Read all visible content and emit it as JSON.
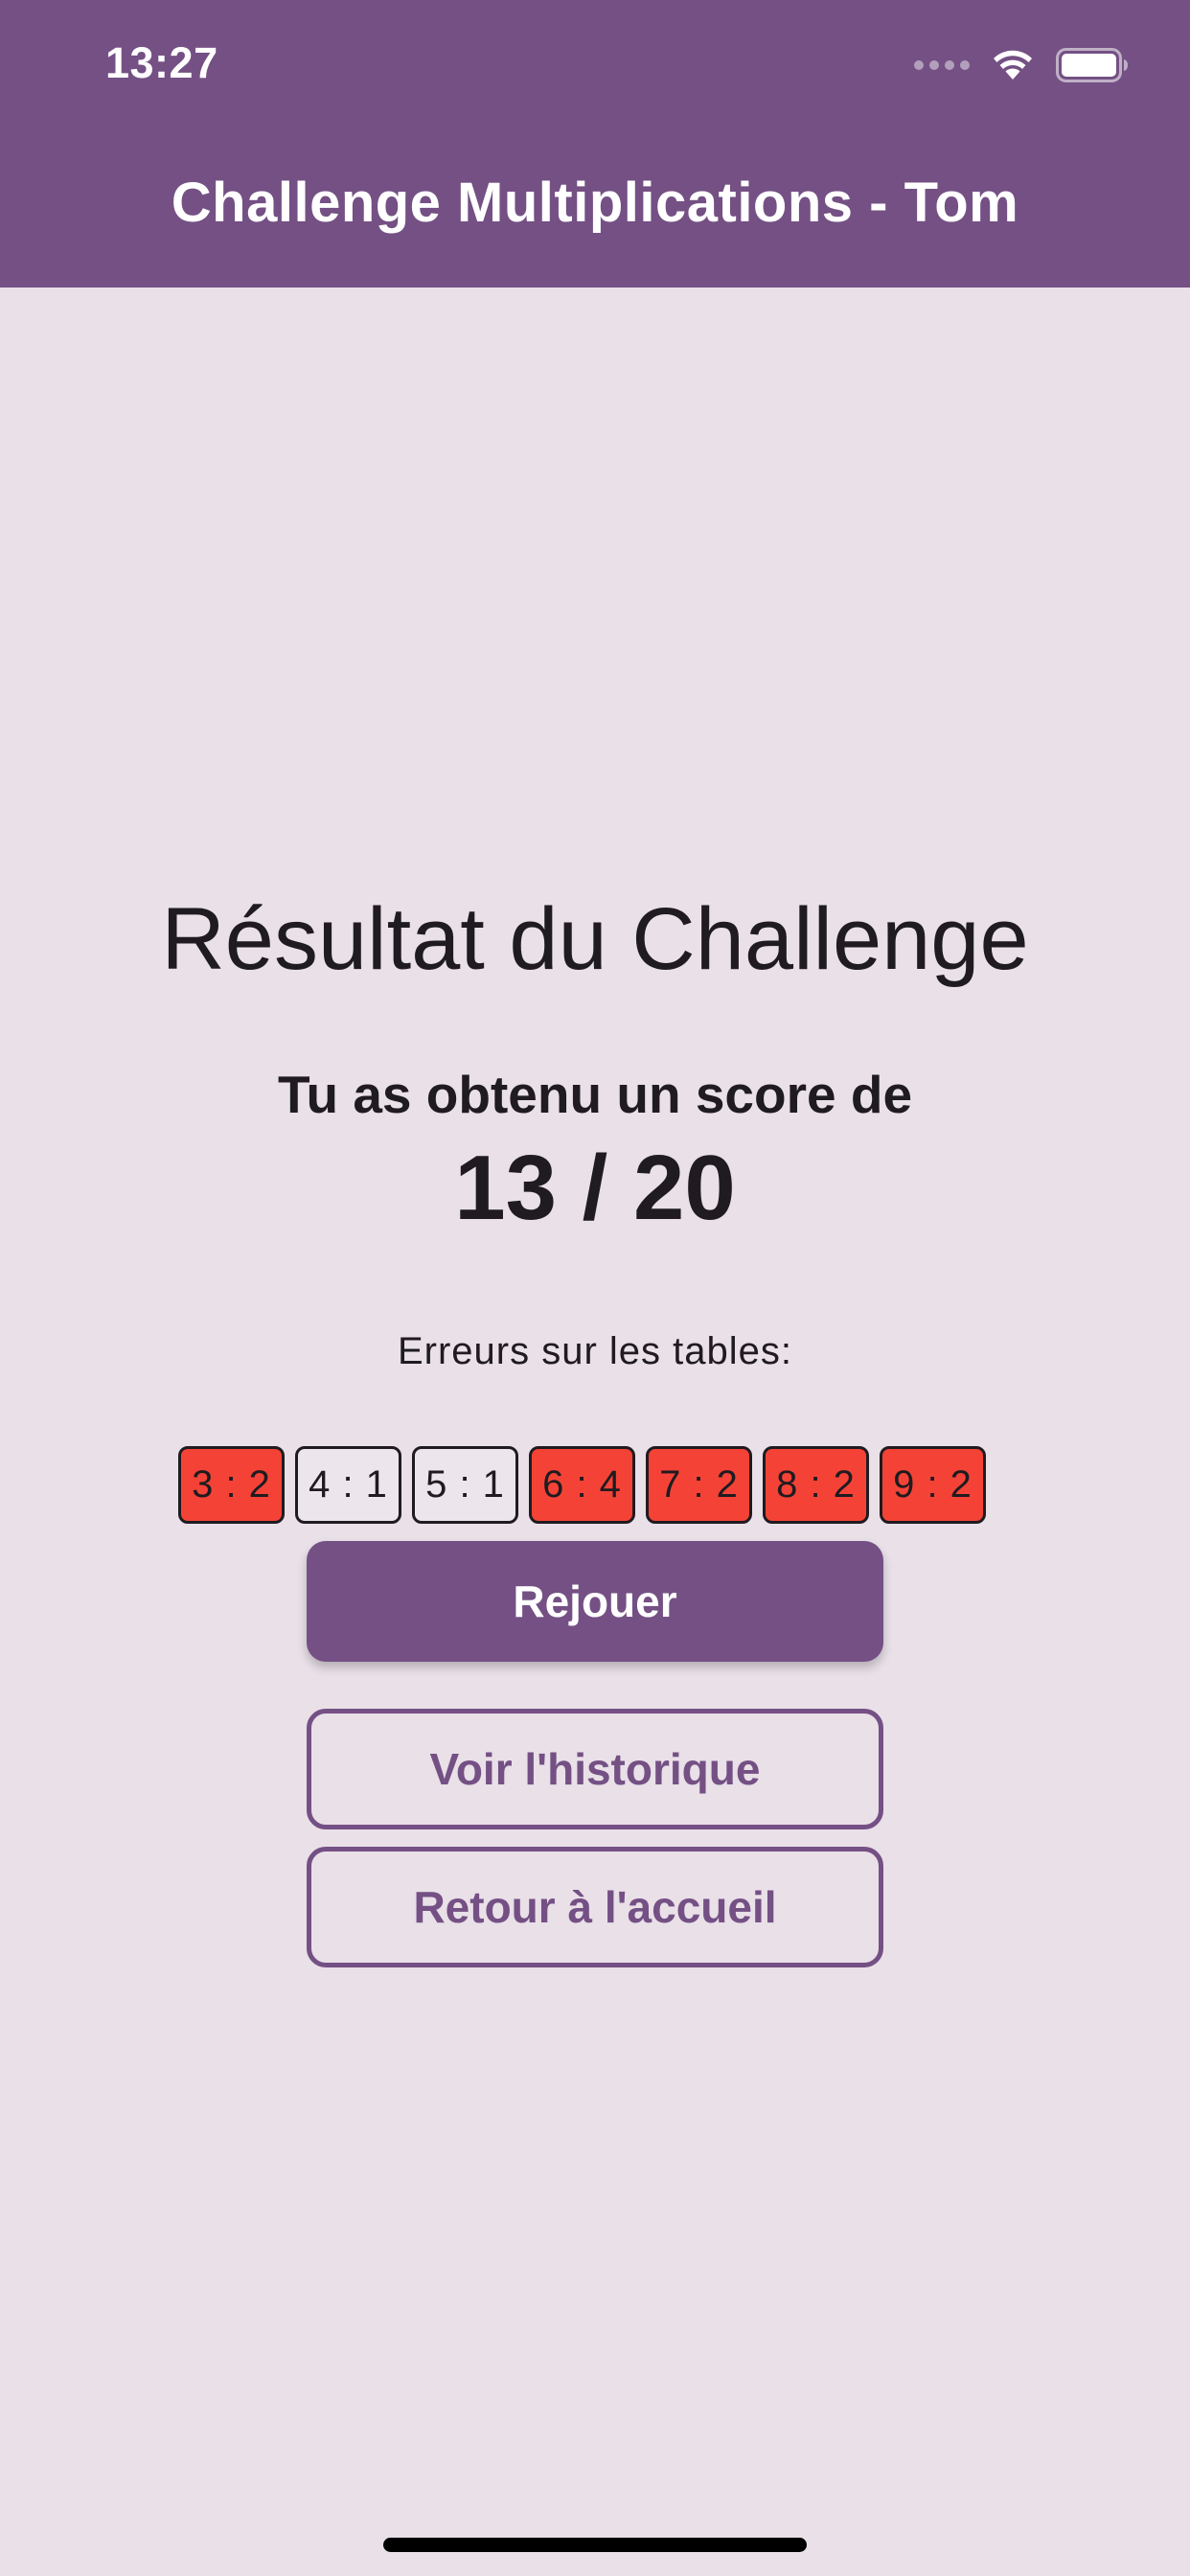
{
  "status_bar": {
    "time": "13:27"
  },
  "app_bar": {
    "title": "Challenge Multiplications - Tom",
    "color": "#745084"
  },
  "result": {
    "title": "Résultat du Challenge",
    "score_label": "Tu as obtenu un score de",
    "score_value": "13 / 20",
    "errors_label": "Erreurs sur les tables:"
  },
  "tables": [
    {
      "label": "3 : 2",
      "status": "error"
    },
    {
      "label": "4 : 1",
      "status": "ok"
    },
    {
      "label": "5 : 1",
      "status": "ok"
    },
    {
      "label": "6 : 4",
      "status": "error"
    },
    {
      "label": "7 : 2",
      "status": "error"
    },
    {
      "label": "8 : 2",
      "status": "error"
    },
    {
      "label": "9 : 2",
      "status": "error"
    }
  ],
  "colors": {
    "error": "#f44336",
    "ok": "#ece6ec",
    "background": "#e9e0e8"
  },
  "buttons": {
    "replay": "Rejouer",
    "history": "Voir l'historique",
    "home": "Retour à l'accueil"
  },
  "icons": {
    "signal": "cellular-signal-icon",
    "wifi": "wifi-icon",
    "battery": "battery-icon"
  }
}
